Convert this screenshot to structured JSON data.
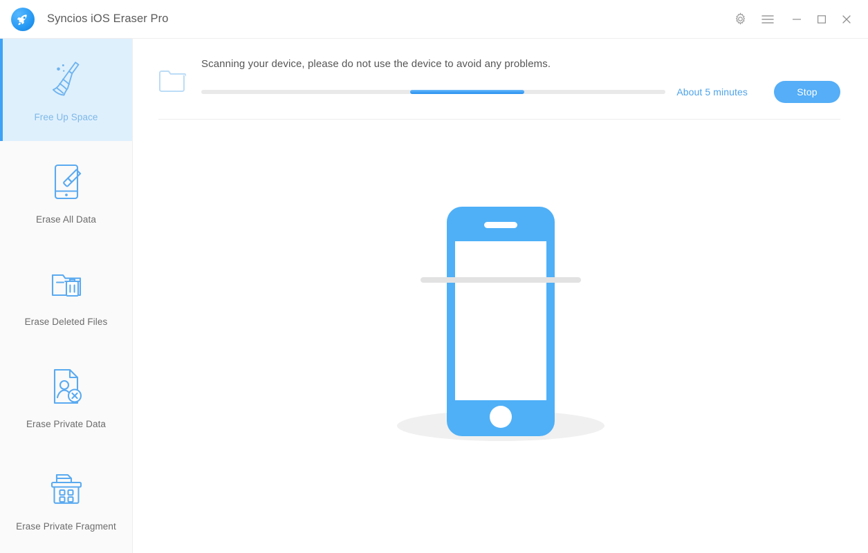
{
  "window": {
    "title": "Syncios iOS Eraser Pro",
    "logo_icon": "syncios-rocket-logo",
    "controls": [
      {
        "name": "settings-button",
        "icon": "gear-icon",
        "label": "Settings"
      },
      {
        "name": "menu-button",
        "icon": "hamburger-icon",
        "label": "Menu"
      },
      {
        "name": "minimize-button",
        "icon": "minimize-icon",
        "label": "Minimize"
      },
      {
        "name": "maximize-button",
        "icon": "maximize-icon",
        "label": "Maximize"
      },
      {
        "name": "close-button",
        "icon": "close-icon",
        "label": "Close"
      }
    ]
  },
  "sidebar": {
    "items": [
      {
        "label": "Free Up Space",
        "icon": "broom-icon",
        "active": true
      },
      {
        "label": "Erase All Data",
        "icon": "phone-eraser-icon",
        "active": false
      },
      {
        "label": "Erase Deleted Files",
        "icon": "folder-trash-icon",
        "active": false
      },
      {
        "label": "Erase Private Data",
        "icon": "document-user-x-icon",
        "active": false
      },
      {
        "label": "Erase Private Fragment",
        "icon": "fragment-box-icon",
        "active": false
      }
    ]
  },
  "scan": {
    "icon": "folder-icon",
    "message": "Scanning your device, please do not use the device to avoid any problems.",
    "eta": "About 5 minutes",
    "stop_label": "Stop",
    "progress_start_pct": 45,
    "progress_width_pct": 24.5
  },
  "illustration": {
    "name": "iphone-scanning-illustration",
    "device": "iphone"
  },
  "colors": {
    "accent": "#3ea2f5",
    "phone_blue": "#4fb0f7",
    "active_bg": "#dff0fd",
    "sidebar_bg": "#fafafa",
    "track": "#e9e9e9",
    "text": "#555555",
    "label": "#6b6b6b"
  }
}
